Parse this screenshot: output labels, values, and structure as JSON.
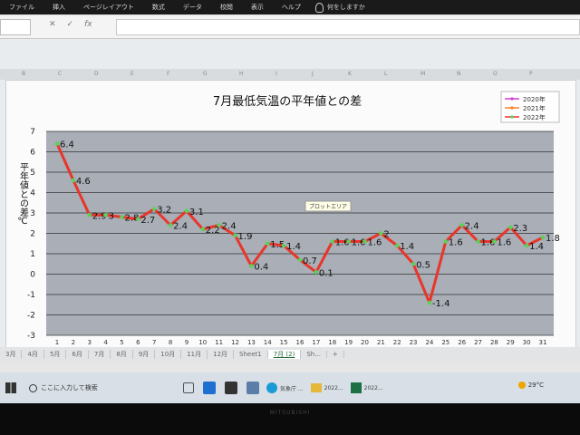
{
  "ribbon": {
    "tabs": [
      "ファイル",
      "挿入",
      "ページレイアウト",
      "数式",
      "データ",
      "校閲",
      "表示",
      "ヘルプ"
    ],
    "help_search": "何をしますか"
  },
  "formula_bar": {
    "cancel_symbol": "✕",
    "enter_symbol": "✓",
    "fx_symbol": "fx"
  },
  "columns": [
    "B",
    "C",
    "D",
    "E",
    "F",
    "G",
    "H",
    "I",
    "J",
    "K",
    "L",
    "M",
    "N",
    "O",
    "P"
  ],
  "chart_data": {
    "type": "line",
    "title": "7月最低気温の平年値との差",
    "ylabel": "平年値との差℃",
    "xlabel": "",
    "ylim": [
      -3,
      7
    ],
    "yticks": [
      -3,
      -2,
      -1,
      0,
      1,
      2,
      3,
      4,
      5,
      6,
      7
    ],
    "x": [
      1,
      2,
      3,
      4,
      5,
      6,
      7,
      8,
      9,
      10,
      11,
      12,
      13,
      14,
      15,
      16,
      17,
      18,
      19,
      20,
      21,
      22,
      23,
      24,
      25,
      26,
      27,
      28,
      29,
      30,
      31
    ],
    "grid": true,
    "legend_position": "top-right",
    "series": [
      {
        "name": "2020年",
        "color": "#d63cd6",
        "values": []
      },
      {
        "name": "2021年",
        "color": "#ff7a2a",
        "values": []
      },
      {
        "name": "2022年",
        "color": "#e8362b",
        "marker_color": "#5ad15a",
        "values": [
          6.4,
          4.6,
          2.9,
          2.9,
          2.8,
          2.7,
          3.2,
          2.4,
          3.1,
          2.2,
          2.4,
          1.9,
          0.4,
          1.5,
          1.4,
          0.7,
          0.1,
          1.6,
          1.6,
          1.6,
          2,
          1.4,
          0.5,
          -1.4,
          1.6,
          2.4,
          1.6,
          1.6,
          2.3,
          1.4,
          1.8
        ],
        "data_labels": [
          "6.4",
          "4.6",
          "2.9",
          "3",
          "2.8",
          "2.7",
          "3.2",
          "2.4",
          "3.1",
          "2.2",
          "2.4",
          "1.9",
          "0.4",
          "1.5",
          "1.4",
          "0.7",
          "0.1",
          "1.6",
          "1.6",
          "1.6",
          "2",
          "1.4",
          "0.5",
          "-1.4",
          "1.6",
          "2.4",
          "1.6",
          "1.6",
          "2.3",
          "1.4",
          "1.8"
        ]
      }
    ],
    "plot_area_color": "#a9aeb7",
    "tooltip": "プロットエリア"
  },
  "sheet_tabs": [
    "3月",
    "4月",
    "5月",
    "6月",
    "7月",
    "8月",
    "9月",
    "10月",
    "11月",
    "12月",
    "Sheet1",
    "7月 (2)",
    "Sh...",
    "+"
  ],
  "active_sheet_index": 11,
  "taskbar": {
    "search_placeholder": "ここに入力して検索",
    "apps": [
      "気象庁 ...",
      "2022...",
      "2022..."
    ],
    "weather": "29°C"
  },
  "brand": "MITSUBISHI"
}
